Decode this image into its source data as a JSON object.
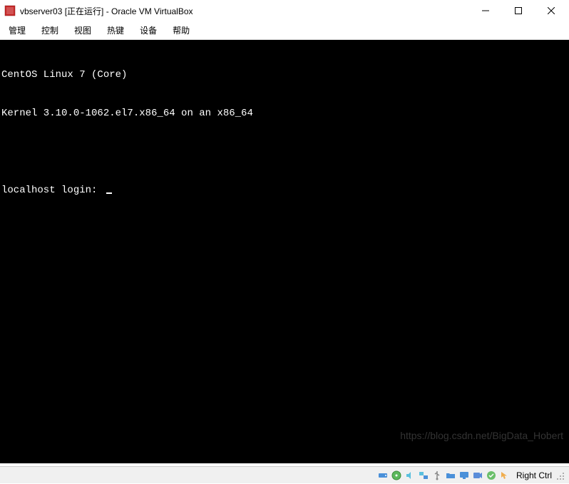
{
  "titlebar": {
    "title": "vbserver03 [正在运行] - Oracle VM VirtualBox"
  },
  "menubar": {
    "items": [
      "管理",
      "控制",
      "视图",
      "热键",
      "设备",
      "帮助"
    ]
  },
  "console": {
    "line1": "CentOS Linux 7 (Core)",
    "line2": "Kernel 3.10.0-1062.el7.x86_64 on an x86_64",
    "prompt": "localhost login: "
  },
  "watermark": "https://blog.csdn.net/BigData_Hobert",
  "statusbar": {
    "host_key": "Right Ctrl"
  }
}
